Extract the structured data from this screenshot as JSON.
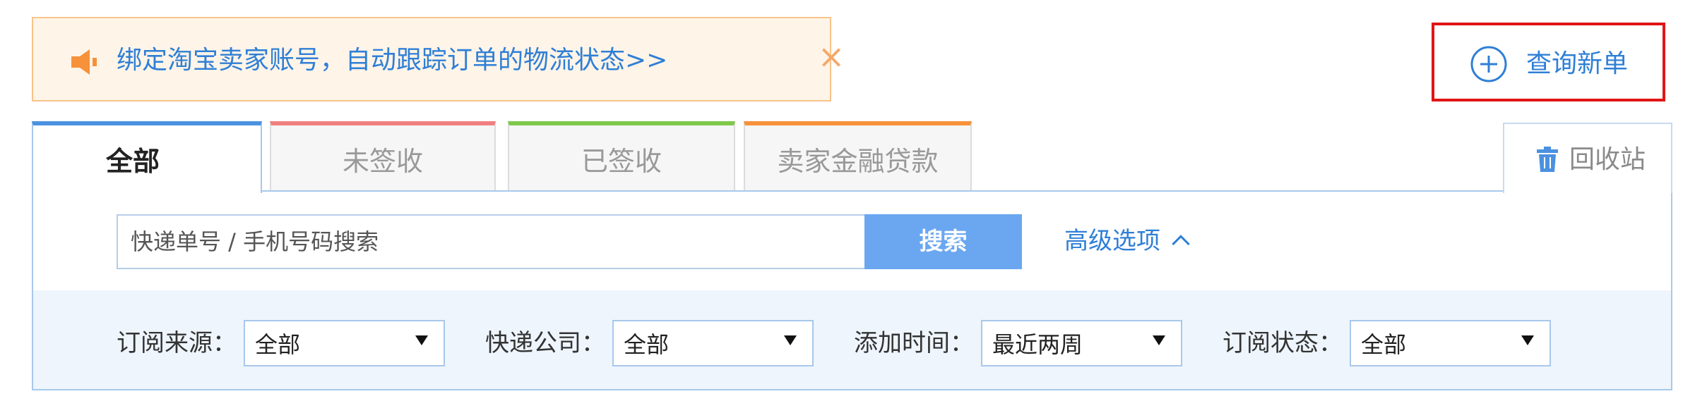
{
  "notice": {
    "text": "绑定淘宝卖家账号，自动跟踪订单的物流状态>>",
    "close": "×"
  },
  "new_query": {
    "label": "查询新单"
  },
  "tabs": [
    {
      "label": "全部",
      "color": "#4b91e0",
      "active": true
    },
    {
      "label": "未签收",
      "color": "#f08080"
    },
    {
      "label": "已签收",
      "color": "#7ec84a"
    },
    {
      "label": "卖家金融贷款",
      "color": "#f7913a"
    }
  ],
  "recycle": {
    "label": "回收站"
  },
  "search": {
    "placeholder": "快递单号 / 手机号码搜索",
    "button": "搜索"
  },
  "advanced": {
    "label": "高级选项"
  },
  "filters": [
    {
      "label": "订阅来源：",
      "value": "全部"
    },
    {
      "label": "快递公司：",
      "value": "全部"
    },
    {
      "label": "添加时间：",
      "value": "最近两周"
    },
    {
      "label": "订阅状态：",
      "value": "全部"
    }
  ],
  "colors": {
    "accent": "#2f7fd6",
    "search_button": "#6aa7f0",
    "highlight_border": "#e01515",
    "notice_bg": "#fff4e8"
  }
}
